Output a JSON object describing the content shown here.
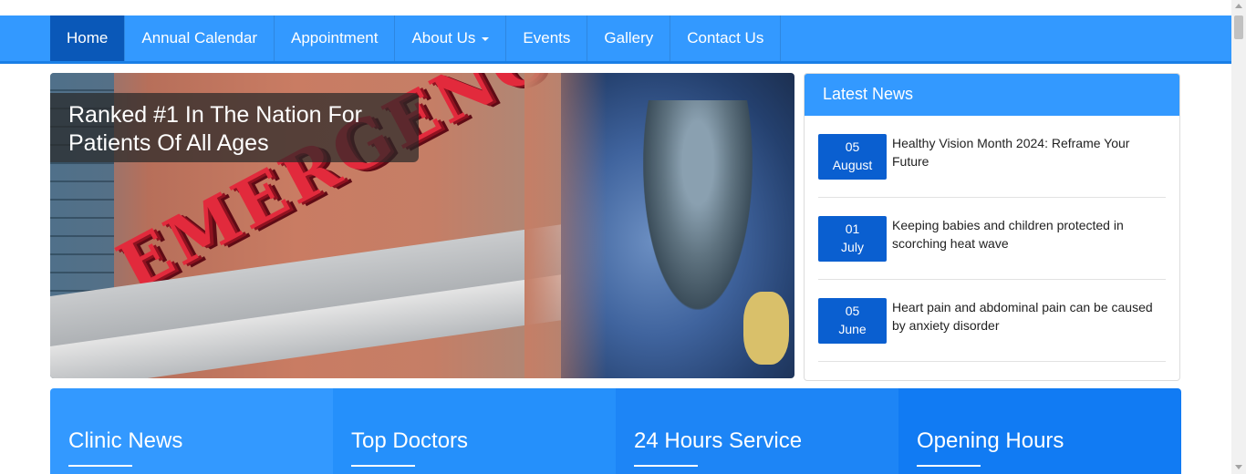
{
  "nav": {
    "items": [
      {
        "label": "Home",
        "active": true
      },
      {
        "label": "Annual Calendar"
      },
      {
        "label": "Appointment"
      },
      {
        "label": "About Us",
        "dropdown": true
      },
      {
        "label": "Events"
      },
      {
        "label": "Gallery"
      },
      {
        "label": "Contact Us"
      }
    ]
  },
  "hero": {
    "caption_line1": "Ranked #1 In The Nation For",
    "caption_line2": "Patients Of All Ages",
    "sign_text": "EMERGENCY"
  },
  "news": {
    "title": "Latest News",
    "items": [
      {
        "day": "05",
        "month": "August",
        "text": "Healthy Vision Month 2024: Reframe Your Future"
      },
      {
        "day": "01",
        "month": "July",
        "text": "Keeping babies and children protected in scorching heat wave"
      },
      {
        "day": "05",
        "month": "June",
        "text": "Heart pain and abdominal pain can be caused by anxiety disorder"
      }
    ]
  },
  "features": [
    {
      "title": "Clinic News"
    },
    {
      "title": "Top Doctors"
    },
    {
      "title": "24 Hours Service"
    },
    {
      "title": "Opening Hours"
    }
  ],
  "colors": {
    "nav_bg": "#3399ff",
    "nav_active": "#0a58b8",
    "date_box": "#0a5fd0"
  }
}
